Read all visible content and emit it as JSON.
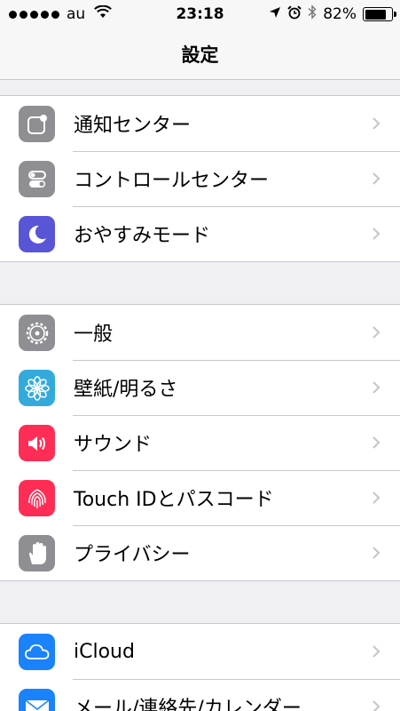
{
  "status_bar": {
    "carrier": "au",
    "time": "23:18",
    "battery": "82%",
    "battery_level": 0.82,
    "signal_bars": 5
  },
  "nav": {
    "title": "設定"
  },
  "groups": [
    {
      "items": [
        {
          "label": "通知センター",
          "icon": "notification-center-icon",
          "color": "#8e8e93"
        },
        {
          "label": "コントロールセンター",
          "icon": "control-center-icon",
          "color": "#8e8e93"
        },
        {
          "label": "おやすみモード",
          "icon": "moon-icon",
          "color": "#5856d6"
        }
      ]
    },
    {
      "items": [
        {
          "label": "一般",
          "icon": "gear-icon",
          "color": "#8e8e93"
        },
        {
          "label": "壁紙/明るさ",
          "icon": "flower-icon",
          "color": "#34aadc"
        },
        {
          "label": "サウンド",
          "icon": "speaker-icon",
          "color": "#ff2d55"
        },
        {
          "label": "Touch IDとパスコード",
          "icon": "fingerprint-icon",
          "color": "#ff2d55"
        },
        {
          "label": "プライバシー",
          "icon": "hand-icon",
          "color": "#8e8e93"
        }
      ]
    },
    {
      "items": [
        {
          "label": "iCloud",
          "icon": "cloud-icon",
          "color": "#1a82fb"
        },
        {
          "label": "メール/連絡先/カレンダー",
          "icon": "mail-icon",
          "color": "#1a82fb"
        }
      ]
    }
  ]
}
